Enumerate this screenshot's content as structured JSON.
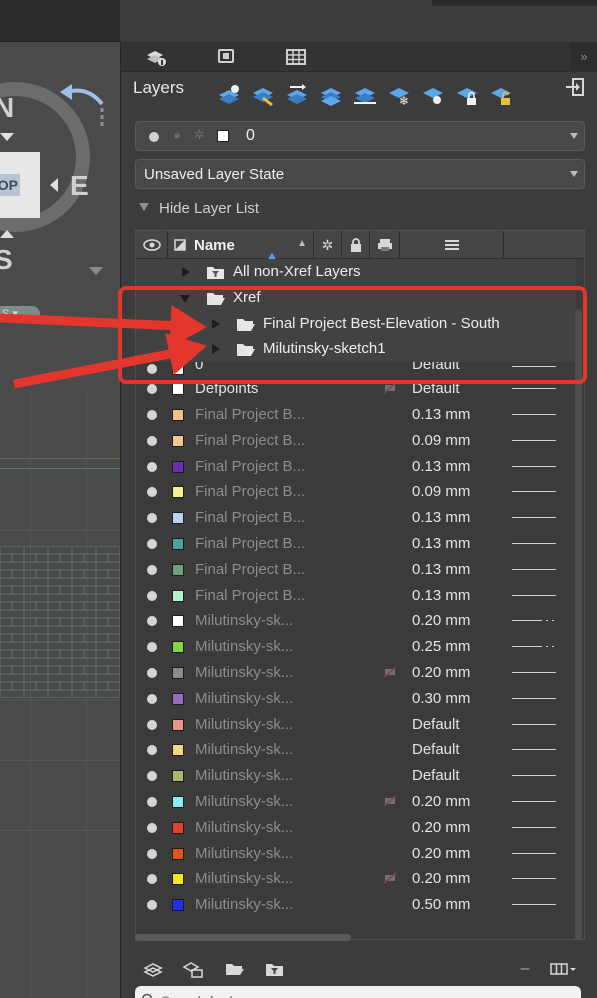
{
  "viewcube": {
    "north": "N",
    "east": "E",
    "south": "S",
    "top_face": "OP",
    "wcs": "S"
  },
  "palette": {
    "title": "Layers",
    "collapse_glyph": "»",
    "current_layer": {
      "name": "0",
      "color": "#ffffff"
    },
    "layer_state": "Unsaved Layer State",
    "hide_list_label": "Hide Layer List",
    "columns": {
      "name": "Name"
    },
    "groups": [
      {
        "label": "All non-Xref Layers",
        "expanded": false
      },
      {
        "label": "Xref",
        "expanded": true
      },
      {
        "label": "Final Project Best-Elevation - South",
        "expanded": false
      },
      {
        "label": "Milutinsky-sketch1",
        "expanded": false
      }
    ],
    "partial_row": {
      "name": "0",
      "lineweight": "Default"
    },
    "layers": [
      {
        "name": "Defpoints",
        "color": "#ffffff",
        "lineweight": "Default",
        "no_plot": true,
        "bright": true
      },
      {
        "name": "Final Project B...",
        "color": "#f2c08c",
        "lineweight": "0.13 mm"
      },
      {
        "name": "Final Project B...",
        "color": "#f4c690",
        "lineweight": "0.09 mm"
      },
      {
        "name": "Final Project B...",
        "color": "#6a2fb0",
        "lineweight": "0.13 mm"
      },
      {
        "name": "Final Project B...",
        "color": "#f6ef8e",
        "lineweight": "0.09 mm"
      },
      {
        "name": "Final Project B...",
        "color": "#b8d2f2",
        "lineweight": "0.13 mm"
      },
      {
        "name": "Final Project B...",
        "color": "#4f9ea2",
        "lineweight": "0.13 mm"
      },
      {
        "name": "Final Project B...",
        "color": "#6fa07e",
        "lineweight": "0.13 mm"
      },
      {
        "name": "Final Project B...",
        "color": "#b2f2c8",
        "lineweight": "0.13 mm"
      },
      {
        "name": "Milutinsky-sk...",
        "color": "#ffffff",
        "lineweight": "0.20 mm",
        "dashed": true
      },
      {
        "name": "Milutinsky-sk...",
        "color": "#82d83a",
        "lineweight": "0.25 mm",
        "dashed": true
      },
      {
        "name": "Milutinsky-sk...",
        "color": "#8c8c8c",
        "lineweight": "0.20 mm",
        "no_plot": true
      },
      {
        "name": "Milutinsky-sk...",
        "color": "#9a6ac0",
        "lineweight": "0.30 mm"
      },
      {
        "name": "Milutinsky-sk...",
        "color": "#e6958a",
        "lineweight": "Default"
      },
      {
        "name": "Milutinsky-sk...",
        "color": "#f2d682",
        "lineweight": "Default"
      },
      {
        "name": "Milutinsky-sk...",
        "color": "#a9b86a",
        "lineweight": "Default"
      },
      {
        "name": "Milutinsky-sk...",
        "color": "#86eef2",
        "lineweight": "0.20 mm",
        "no_plot": true
      },
      {
        "name": "Milutinsky-sk...",
        "color": "#e0432c",
        "lineweight": "0.20 mm"
      },
      {
        "name": "Milutinsky-sk...",
        "color": "#e0531f",
        "lineweight": "0.20 mm"
      },
      {
        "name": "Milutinsky-sk...",
        "color": "#f2e81c",
        "lineweight": "0.20 mm",
        "no_plot": true
      },
      {
        "name": "Milutinsky-sk...",
        "color": "#2232e6",
        "lineweight": "0.50 mm"
      }
    ],
    "search_placeholder": "Search for layer"
  },
  "annotation": {
    "color": "#e3372e"
  }
}
